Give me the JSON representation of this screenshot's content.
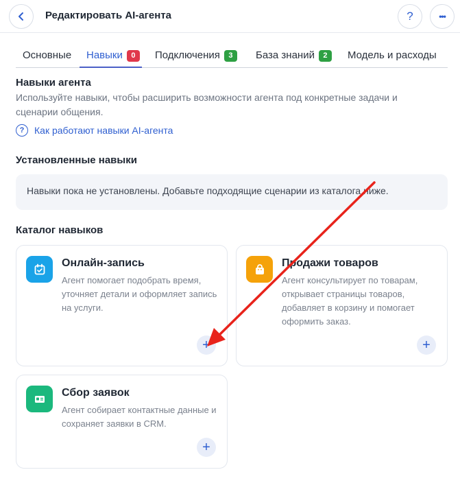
{
  "header": {
    "title": "Редактировать AI-агента",
    "help_label": "?",
    "more_label": "•••"
  },
  "tabs": [
    {
      "label": "Основные",
      "badge": null
    },
    {
      "label": "Навыки",
      "badge": "0",
      "badge_color": "#e0384b",
      "active": true
    },
    {
      "label": "Подключения",
      "badge": "3",
      "badge_color": "#2ea043"
    },
    {
      "label": "База знаний",
      "badge": "2",
      "badge_color": "#2ea043"
    },
    {
      "label": "Модель и расходы",
      "badge": null
    }
  ],
  "skills_intro": {
    "title": "Навыки агента",
    "description": "Используйте навыки, чтобы расширить возможности агента под конкретные задачи и сценарии общения.",
    "help_link": "Как работают навыки AI-агента"
  },
  "installed": {
    "title": "Установленные навыки",
    "empty_text": "Навыки пока не установлены. Добавьте подходящие сценарии из каталога ниже."
  },
  "catalog": {
    "title": "Каталог навыков",
    "cards": [
      {
        "title": "Онлайн-запись",
        "description": "Агент помогает подобрать время, уточняет детали и оформляет запись на услуги.",
        "icon": "calendar-icon",
        "icon_color": "#1aa3e8"
      },
      {
        "title": "Продажи товаров",
        "description": "Агент консультирует по товарам, открывает страницы товаров, добавляет в корзину и помогает оформить заказ.",
        "icon": "shopping-bag-icon",
        "icon_color": "#f5a20a"
      },
      {
        "title": "Сбор заявок",
        "description": "Агент собирает контактные данные и сохраняет заявки в CRM.",
        "icon": "contact-card-icon",
        "icon_color": "#1bb87d"
      }
    ],
    "add_label": "+"
  },
  "colors": {
    "accent": "#2f5fd0",
    "annotation_arrow": "#e8231b"
  }
}
